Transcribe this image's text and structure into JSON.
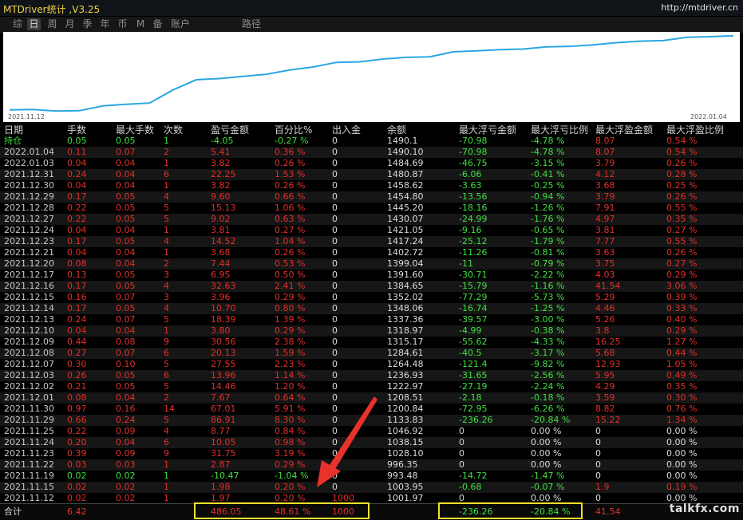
{
  "app": {
    "title": "MTDriver统计 ,V3.25",
    "url": "http://mtdriver.cn"
  },
  "tabs": [
    {
      "label": "综",
      "active": false
    },
    {
      "label": "日",
      "active": true
    },
    {
      "label": "周",
      "active": false
    },
    {
      "label": "月",
      "active": false
    },
    {
      "label": "季",
      "active": false
    },
    {
      "label": "年",
      "active": false
    },
    {
      "label": "币",
      "active": false
    },
    {
      "label": "M",
      "active": false
    },
    {
      "label": "备",
      "active": false
    },
    {
      "label": "账户",
      "active": false
    },
    {
      "label": "路径",
      "active": false
    }
  ],
  "equity_chart": {
    "start_label": "2021.11.12",
    "end_label": "2022.01.04",
    "line_color": "#2aa7e0"
  },
  "chart_data": {
    "type": "line",
    "x": [
      "2021.11.12",
      "2021.11.15",
      "2021.11.19",
      "2021.11.22",
      "2021.11.23",
      "2021.11.24",
      "2021.11.25",
      "2021.11.29",
      "2021.11.30",
      "2021.12.01",
      "2021.12.02",
      "2021.12.03",
      "2021.12.07",
      "2021.12.08",
      "2021.12.09",
      "2021.12.10",
      "2021.12.13",
      "2021.12.14",
      "2021.12.15",
      "2021.12.16",
      "2021.12.17",
      "2021.12.20",
      "2021.12.21",
      "2021.12.23",
      "2021.12.24",
      "2021.12.27",
      "2021.12.28",
      "2021.12.29",
      "2021.12.30",
      "2021.12.31",
      "2022.01.03",
      "2022.01.04"
    ],
    "series": [
      {
        "values": [
          1001.97,
          1003.95,
          993.48,
          996.35,
          1028.1,
          1038.15,
          1046.92,
          1133.83,
          1200.84,
          1208.51,
          1222.97,
          1236.93,
          1264.48,
          1284.61,
          1315.17,
          1318.97,
          1337.36,
          1348.06,
          1352.02,
          1384.65,
          1391.6,
          1399.04,
          1402.72,
          1417.24,
          1421.05,
          1430.07,
          1445.2,
          1454.8,
          1458.62,
          1480.87,
          1484.69,
          1490.1
        ]
      }
    ],
    "xlabel": "",
    "ylabel": "",
    "grid": false
  },
  "columns": [
    "日期",
    "手数",
    "最大手数",
    "次数",
    "盈亏金额",
    "百分比%",
    "出入金",
    "余额",
    "最大浮亏金额",
    "最大浮亏比例",
    "最大浮盈金额",
    "最大浮盈比例"
  ],
  "rows": [
    {
      "date": "持仓",
      "lots": "0.05",
      "max_lots": "0.05",
      "count": "1",
      "pnl": "-4.05",
      "pct": "-0.27 %",
      "io": "0",
      "balance": "1490.1",
      "max_fl_amt": "-70.98",
      "max_fl_pct": "-4.78 %",
      "max_fp_amt": "8.07",
      "max_fp_pct": "0.54 %",
      "tone": "green"
    },
    {
      "date": "2022.01.04",
      "lots": "0.11",
      "max_lots": "0.07",
      "count": "2",
      "pnl": "5.41",
      "pct": "0.36 %",
      "io": "0",
      "balance": "1490.10",
      "max_fl_amt": "-70.98",
      "max_fl_pct": "-4.78 %",
      "max_fp_amt": "8.07",
      "max_fp_pct": "0.54 %",
      "tone": "red"
    },
    {
      "date": "2022.01.03",
      "lots": "0.04",
      "max_lots": "0.04",
      "count": "1",
      "pnl": "3.82",
      "pct": "0.26 %",
      "io": "0",
      "balance": "1484.69",
      "max_fl_amt": "-46.75",
      "max_fl_pct": "-3.15 %",
      "max_fp_amt": "3.79",
      "max_fp_pct": "0.26 %",
      "tone": "red"
    },
    {
      "date": "2021.12.31",
      "lots": "0.24",
      "max_lots": "0.04",
      "count": "6",
      "pnl": "22.25",
      "pct": "1.53 %",
      "io": "0",
      "balance": "1480.87",
      "max_fl_amt": "-6.06",
      "max_fl_pct": "-0.41 %",
      "max_fp_amt": "4.12",
      "max_fp_pct": "0.28 %",
      "tone": "red"
    },
    {
      "date": "2021.12.30",
      "lots": "0.04",
      "max_lots": "0.04",
      "count": "1",
      "pnl": "3.82",
      "pct": "0.26 %",
      "io": "0",
      "balance": "1458.62",
      "max_fl_amt": "-3.63",
      "max_fl_pct": "-0.25 %",
      "max_fp_amt": "3.68",
      "max_fp_pct": "0.25 %",
      "tone": "red"
    },
    {
      "date": "2021.12.29",
      "lots": "0.17",
      "max_lots": "0.05",
      "count": "4",
      "pnl": "9.60",
      "pct": "0.66 %",
      "io": "0",
      "balance": "1454.80",
      "max_fl_amt": "-13.56",
      "max_fl_pct": "-0.94 %",
      "max_fp_amt": "3.79",
      "max_fp_pct": "0.26 %",
      "tone": "red"
    },
    {
      "date": "2021.12.28",
      "lots": "0.22",
      "max_lots": "0.05",
      "count": "5",
      "pnl": "15.13",
      "pct": "1.06 %",
      "io": "0",
      "balance": "1445.20",
      "max_fl_amt": "-18.16",
      "max_fl_pct": "-1.26 %",
      "max_fp_amt": "7.91",
      "max_fp_pct": "0.55 %",
      "tone": "red"
    },
    {
      "date": "2021.12.27",
      "lots": "0.22",
      "max_lots": "0.05",
      "count": "5",
      "pnl": "9.02",
      "pct": "0.63 %",
      "io": "0",
      "balance": "1430.07",
      "max_fl_amt": "-24.99",
      "max_fl_pct": "-1.76 %",
      "max_fp_amt": "4.97",
      "max_fp_pct": "0.35 %",
      "tone": "red"
    },
    {
      "date": "2021.12.24",
      "lots": "0.04",
      "max_lots": "0.04",
      "count": "1",
      "pnl": "3.81",
      "pct": "0.27 %",
      "io": "0",
      "balance": "1421.05",
      "max_fl_amt": "-9.16",
      "max_fl_pct": "-0.65 %",
      "max_fp_amt": "3.81",
      "max_fp_pct": "0.27 %",
      "tone": "red"
    },
    {
      "date": "2021.12.23",
      "lots": "0.17",
      "max_lots": "0.05",
      "count": "4",
      "pnl": "14.52",
      "pct": "1.04 %",
      "io": "0",
      "balance": "1417.24",
      "max_fl_amt": "-25.12",
      "max_fl_pct": "-1.79 %",
      "max_fp_amt": "7.77",
      "max_fp_pct": "0.55 %",
      "tone": "red"
    },
    {
      "date": "2021.12.21",
      "lots": "0.04",
      "max_lots": "0.04",
      "count": "1",
      "pnl": "3.68",
      "pct": "0.26 %",
      "io": "0",
      "balance": "1402.72",
      "max_fl_amt": "-11.26",
      "max_fl_pct": "-0.81 %",
      "max_fp_amt": "3.63",
      "max_fp_pct": "0.26 %",
      "tone": "red"
    },
    {
      "date": "2021.12.20",
      "lots": "0.08",
      "max_lots": "0.04",
      "count": "2",
      "pnl": "7.44",
      "pct": "0.53 %",
      "io": "0",
      "balance": "1399.04",
      "max_fl_amt": "-11",
      "max_fl_pct": "-0.79 %",
      "max_fp_amt": "3.75",
      "max_fp_pct": "0.27 %",
      "tone": "red"
    },
    {
      "date": "2021.12.17",
      "lots": "0.13",
      "max_lots": "0.05",
      "count": "3",
      "pnl": "6.95",
      "pct": "0.50 %",
      "io": "0",
      "balance": "1391.60",
      "max_fl_amt": "-30.71",
      "max_fl_pct": "-2.22 %",
      "max_fp_amt": "4.03",
      "max_fp_pct": "0.29 %",
      "tone": "red"
    },
    {
      "date": "2021.12.16",
      "lots": "0.17",
      "max_lots": "0.05",
      "count": "4",
      "pnl": "32.63",
      "pct": "2.41 %",
      "io": "0",
      "balance": "1384.65",
      "max_fl_amt": "-15.79",
      "max_fl_pct": "-1.16 %",
      "max_fp_amt": "41.54",
      "max_fp_pct": "3.06 %",
      "tone": "red"
    },
    {
      "date": "2021.12.15",
      "lots": "0.16",
      "max_lots": "0.07",
      "count": "3",
      "pnl": "3.96",
      "pct": "0.29 %",
      "io": "0",
      "balance": "1352.02",
      "max_fl_amt": "-77.29",
      "max_fl_pct": "-5.73 %",
      "max_fp_amt": "5.29",
      "max_fp_pct": "0.39 %",
      "tone": "red"
    },
    {
      "date": "2021.12.14",
      "lots": "0.17",
      "max_lots": "0.05",
      "count": "4",
      "pnl": "10.70",
      "pct": "0.80 %",
      "io": "0",
      "balance": "1348.06",
      "max_fl_amt": "-16.74",
      "max_fl_pct": "-1.25 %",
      "max_fp_amt": "4.46",
      "max_fp_pct": "0.33 %",
      "tone": "red"
    },
    {
      "date": "2021.12.13",
      "lots": "0.24",
      "max_lots": "0.07",
      "count": "5",
      "pnl": "18.39",
      "pct": "1.39 %",
      "io": "0",
      "balance": "1337.36",
      "max_fl_amt": "-39.57",
      "max_fl_pct": "-3.00 %",
      "max_fp_amt": "5.26",
      "max_fp_pct": "0.40 %",
      "tone": "red"
    },
    {
      "date": "2021.12.10",
      "lots": "0.04",
      "max_lots": "0.04",
      "count": "1",
      "pnl": "3.80",
      "pct": "0.29 %",
      "io": "0",
      "balance": "1318.97",
      "max_fl_amt": "-4.99",
      "max_fl_pct": "-0.38 %",
      "max_fp_amt": "3.8",
      "max_fp_pct": "0.29 %",
      "tone": "red"
    },
    {
      "date": "2021.12.09",
      "lots": "0.44",
      "max_lots": "0.08",
      "count": "9",
      "pnl": "30.56",
      "pct": "2.38 %",
      "io": "0",
      "balance": "1315.17",
      "max_fl_amt": "-55.62",
      "max_fl_pct": "-4.33 %",
      "max_fp_amt": "16.25",
      "max_fp_pct": "1.27 %",
      "tone": "red"
    },
    {
      "date": "2021.12.08",
      "lots": "0.27",
      "max_lots": "0.07",
      "count": "6",
      "pnl": "20.13",
      "pct": "1.59 %",
      "io": "0",
      "balance": "1284.61",
      "max_fl_amt": "-40.5",
      "max_fl_pct": "-3.17 %",
      "max_fp_amt": "5.68",
      "max_fp_pct": "0.44 %",
      "tone": "red"
    },
    {
      "date": "2021.12.07",
      "lots": "0.30",
      "max_lots": "0.10",
      "count": "5",
      "pnl": "27.55",
      "pct": "2.23 %",
      "io": "0",
      "balance": "1264.48",
      "max_fl_amt": "-121.4",
      "max_fl_pct": "-9.82 %",
      "max_fp_amt": "12.93",
      "max_fp_pct": "1.05 %",
      "tone": "red"
    },
    {
      "date": "2021.12.03",
      "lots": "0.26",
      "max_lots": "0.05",
      "count": "6",
      "pnl": "13.96",
      "pct": "1.14 %",
      "io": "0",
      "balance": "1236.93",
      "max_fl_amt": "-31.65",
      "max_fl_pct": "-2.56 %",
      "max_fp_amt": "5.95",
      "max_fp_pct": "0.49 %",
      "tone": "red"
    },
    {
      "date": "2021.12.02",
      "lots": "0.21",
      "max_lots": "0.05",
      "count": "5",
      "pnl": "14.46",
      "pct": "1.20 %",
      "io": "0",
      "balance": "1222.97",
      "max_fl_amt": "-27.19",
      "max_fl_pct": "-2.24 %",
      "max_fp_amt": "4.29",
      "max_fp_pct": "0.35 %",
      "tone": "red"
    },
    {
      "date": "2021.12.01",
      "lots": "0.08",
      "max_lots": "0.04",
      "count": "2",
      "pnl": "7.67",
      "pct": "0.64 %",
      "io": "0",
      "balance": "1208.51",
      "max_fl_amt": "-2.18",
      "max_fl_pct": "-0.18 %",
      "max_fp_amt": "3.59",
      "max_fp_pct": "0.30 %",
      "tone": "red"
    },
    {
      "date": "2021.11.30",
      "lots": "0.97",
      "max_lots": "0.16",
      "count": "14",
      "pnl": "67.01",
      "pct": "5.91 %",
      "io": "0",
      "balance": "1200.84",
      "max_fl_amt": "-72.95",
      "max_fl_pct": "-6.26 %",
      "max_fp_amt": "8.82",
      "max_fp_pct": "0.76 %",
      "tone": "red"
    },
    {
      "date": "2021.11.29",
      "lots": "0.66",
      "max_lots": "0.24",
      "count": "5",
      "pnl": "86.91",
      "pct": "8.30 %",
      "io": "0",
      "balance": "1133.83",
      "max_fl_amt": "-236.26",
      "max_fl_pct": "-20.84 %",
      "max_fp_amt": "15.22",
      "max_fp_pct": "1.34 %",
      "tone": "red"
    },
    {
      "date": "2021.11.25",
      "lots": "0.22",
      "max_lots": "0.09",
      "count": "4",
      "pnl": "8.77",
      "pct": "0.84 %",
      "io": "0",
      "balance": "1046.92",
      "max_fl_amt": "0",
      "max_fl_pct": "0.00 %",
      "max_fp_amt": "0",
      "max_fp_pct": "0.00 %",
      "tone": "red"
    },
    {
      "date": "2021.11.24",
      "lots": "0.20",
      "max_lots": "0.04",
      "count": "6",
      "pnl": "10.05",
      "pct": "0.98 %",
      "io": "0",
      "balance": "1038.15",
      "max_fl_amt": "0",
      "max_fl_pct": "0.00 %",
      "max_fp_amt": "0",
      "max_fp_pct": "0.00 %",
      "tone": "red"
    },
    {
      "date": "2021.11.23",
      "lots": "0.39",
      "max_lots": "0.09",
      "count": "9",
      "pnl": "31.75",
      "pct": "3.19 %",
      "io": "0",
      "balance": "1028.10",
      "max_fl_amt": "0",
      "max_fl_pct": "0.00 %",
      "max_fp_amt": "0",
      "max_fp_pct": "0.00 %",
      "tone": "red"
    },
    {
      "date": "2021.11.22",
      "lots": "0.03",
      "max_lots": "0.03",
      "count": "1",
      "pnl": "2.87",
      "pct": "0.29 %",
      "io": "0",
      "balance": "996.35",
      "max_fl_amt": "0",
      "max_fl_pct": "0.00 %",
      "max_fp_amt": "0",
      "max_fp_pct": "0.00 %",
      "tone": "red"
    },
    {
      "date": "2021.11.19",
      "lots": "0.02",
      "max_lots": "0.02",
      "count": "1",
      "pnl": "-10.47",
      "pct": "-1.04 %",
      "io": "0",
      "balance": "993.48",
      "max_fl_amt": "-14.72",
      "max_fl_pct": "-1.47 %",
      "max_fp_amt": "0",
      "max_fp_pct": "0.00 %",
      "tone": "green"
    },
    {
      "date": "2021.11.15",
      "lots": "0.02",
      "max_lots": "0.02",
      "count": "1",
      "pnl": "1.98",
      "pct": "0.20 %",
      "io": "0",
      "balance": "1003.95",
      "max_fl_amt": "-0.68",
      "max_fl_pct": "-0.07 %",
      "max_fp_amt": "1.9",
      "max_fp_pct": "0.19 %",
      "tone": "red"
    },
    {
      "date": "2021.11.12",
      "lots": "0.02",
      "max_lots": "0.02",
      "count": "1",
      "pnl": "1.97",
      "pct": "0.20 %",
      "io": "1000",
      "balance": "1001.97",
      "max_fl_amt": "0",
      "max_fl_pct": "0.00 %",
      "max_fp_amt": "0",
      "max_fp_pct": "0.00 %",
      "tone": "red"
    }
  ],
  "totals": {
    "label": "合计",
    "lots": "6.42",
    "pnl": "486.05",
    "pct": "48.61 %",
    "io": "1000",
    "max_fl_amt": "-236.26",
    "max_fl_pct": "-20.84 %",
    "max_fp_amt": "41.54"
  },
  "watermark": "talkfx.com",
  "colors": {
    "profit": "#e0302a",
    "loss": "#3ee03e",
    "highlight": "#f5e12a",
    "arrow": "#e8322c"
  }
}
